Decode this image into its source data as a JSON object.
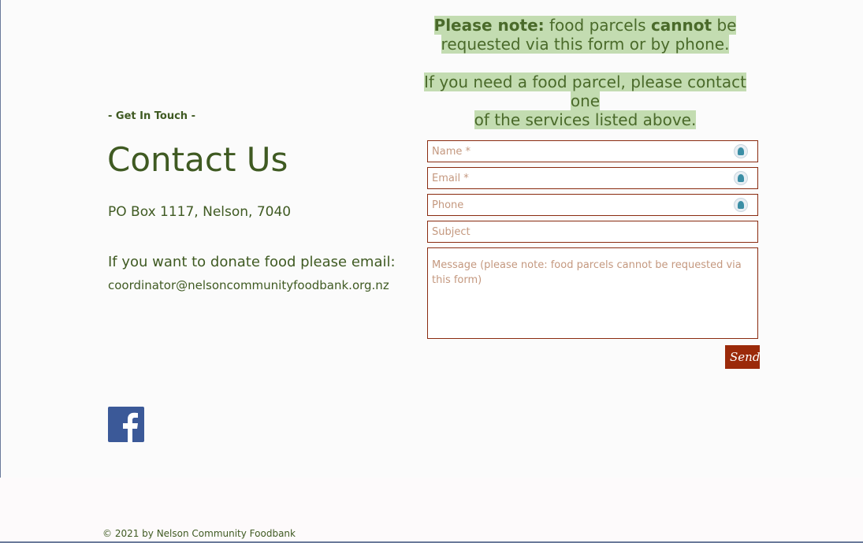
{
  "notice": {
    "line1_bold_a": "Please note:",
    "line1_a": " food parcels ",
    "line1_bold_b": "cannot",
    "line1_b": " be",
    "line2": "requested via this form or by phone.",
    "line3": "If you need a food parcel, please contact one",
    "line4": "of the services listed above."
  },
  "contact": {
    "eyebrow": "- Get In Touch -",
    "title": "Contact Us",
    "address": "PO Box 1117, Nelson, 7040",
    "donate_text": "If you want to donate food please email:",
    "email": "coordinator@nelsoncommunityfoodbank.org.nz"
  },
  "form": {
    "name_placeholder": "Name *",
    "email_placeholder": "Email *",
    "phone_placeholder": "Phone",
    "subject_placeholder": "Subject",
    "message_placeholder": "Message (please note: food parcels cannot be requested via this form)",
    "send_label": "Send"
  },
  "social": {
    "facebook_icon": "facebook-icon"
  },
  "footer": {
    "copyright": "© 2021 by Nelson Community Foodbank"
  },
  "colors": {
    "accent": "#3f5a22",
    "highlight": "#c3dcb1",
    "button": "#9b2a0a",
    "field_border": "#8a2b10"
  }
}
